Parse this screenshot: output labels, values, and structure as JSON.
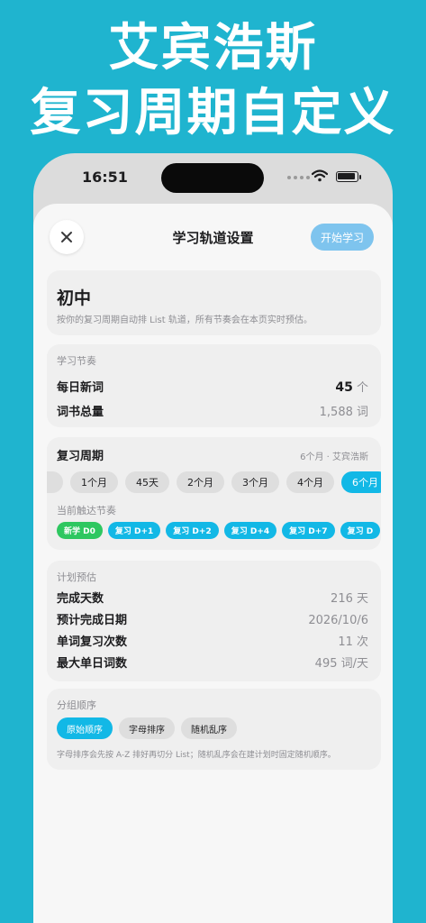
{
  "promo": {
    "line1": "艾宾浩斯",
    "line2": "复习周期自定义"
  },
  "status_bar": {
    "time": "16:51"
  },
  "header": {
    "title": "学习轨道设置",
    "start_button": "开始学习"
  },
  "level": {
    "title": "初中",
    "subtitle": "按你的复习周期自动排 List 轨道，所有节奏会在本页实时预估。"
  },
  "rhythm": {
    "label": "学习节奏",
    "new_words_label": "每日新词",
    "new_words_value": "45",
    "new_words_unit": "个",
    "total_label": "词书总量",
    "total_value": "1,588 词"
  },
  "cycle": {
    "label": "复习周期",
    "selected_summary": "6个月 · 艾宾浩斯",
    "options": [
      "1个月",
      "45天",
      "2个月",
      "3个月",
      "4个月",
      "6个月"
    ],
    "active_index": 5,
    "touch_label": "当前触达节奏",
    "touch_tags": [
      "新学 D0",
      "复习 D+1",
      "复习 D+2",
      "复习 D+4",
      "复习 D+7",
      "复习 D"
    ]
  },
  "estimate": {
    "label": "计划预估",
    "rows": [
      {
        "k": "完成天数",
        "v": "216 天"
      },
      {
        "k": "预计完成日期",
        "v": "2026/10/6"
      },
      {
        "k": "单词复习次数",
        "v": "11 次"
      },
      {
        "k": "最大单日词数",
        "v": "495 词/天"
      }
    ]
  },
  "grouping": {
    "label": "分组顺序",
    "options": [
      "原始顺序",
      "字母排序",
      "随机乱序"
    ],
    "active_index": 0,
    "note": "字母排序会先按 A-Z 排好再切分 List；随机乱序会在建计划时固定随机顺序。"
  },
  "colors": {
    "background": "#1fb4cf",
    "accent": "#12b8e6",
    "green": "#2ec760",
    "start_button": "#7ec4ee"
  }
}
